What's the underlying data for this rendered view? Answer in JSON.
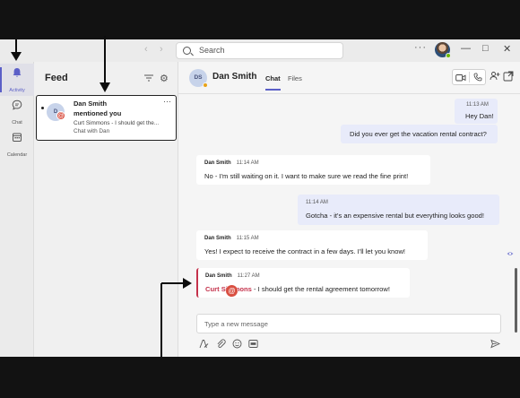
{
  "titlebar": {
    "search_placeholder": "Search",
    "more_label": "···"
  },
  "rail": {
    "items": [
      {
        "label": "Activity",
        "icon": "bell-icon",
        "active": true
      },
      {
        "label": "Chat",
        "icon": "chat-icon"
      },
      {
        "label": "Calendar",
        "icon": "calendar-icon"
      }
    ]
  },
  "feed": {
    "title": "Feed",
    "item": {
      "avatar_initials": "D",
      "name": "Dan Smith",
      "action": "mentioned you",
      "preview": "Curt Simmons - I should get the...",
      "subtitle": "Chat with Dan",
      "more": "···"
    }
  },
  "chat": {
    "contact_initials": "DS",
    "contact_name": "Dan Smith",
    "tabs": [
      "Chat",
      "Files"
    ],
    "messages": [
      {
        "from": "me",
        "time": "11:13 AM",
        "lines": [
          "Hey Dan!"
        ]
      },
      {
        "from": "me",
        "time": "",
        "lines": [
          "Did you ever get the vacation rental contract?"
        ]
      },
      {
        "from": "them",
        "sender": "Dan Smith",
        "time": "11:14 AM",
        "lines": [
          "No - I'm still waiting on it. I want to make sure we read the fine print!"
        ]
      },
      {
        "from": "me",
        "time": "11:14 AM",
        "lines": [
          "Gotcha - it's an expensive rental but everything looks good!"
        ]
      },
      {
        "from": "them",
        "sender": "Dan Smith",
        "time": "11:15 AM",
        "lines": [
          "Yes! I expect to receive the contract in a few days. I'll let you know!"
        ]
      },
      {
        "from": "them",
        "sender": "Dan Smith",
        "time": "11:27 AM",
        "mention": "Curt Simmons",
        "lines": [
          " - I should get the rental agreement tomorrow!"
        ]
      }
    ],
    "mention_badge": "@",
    "composer_placeholder": "Type a new message"
  },
  "colors": {
    "accent": "#5b5fc7",
    "mention": "#c4314b",
    "mention_badge": "#d95042",
    "bubble_me": "#e8ebfa"
  }
}
